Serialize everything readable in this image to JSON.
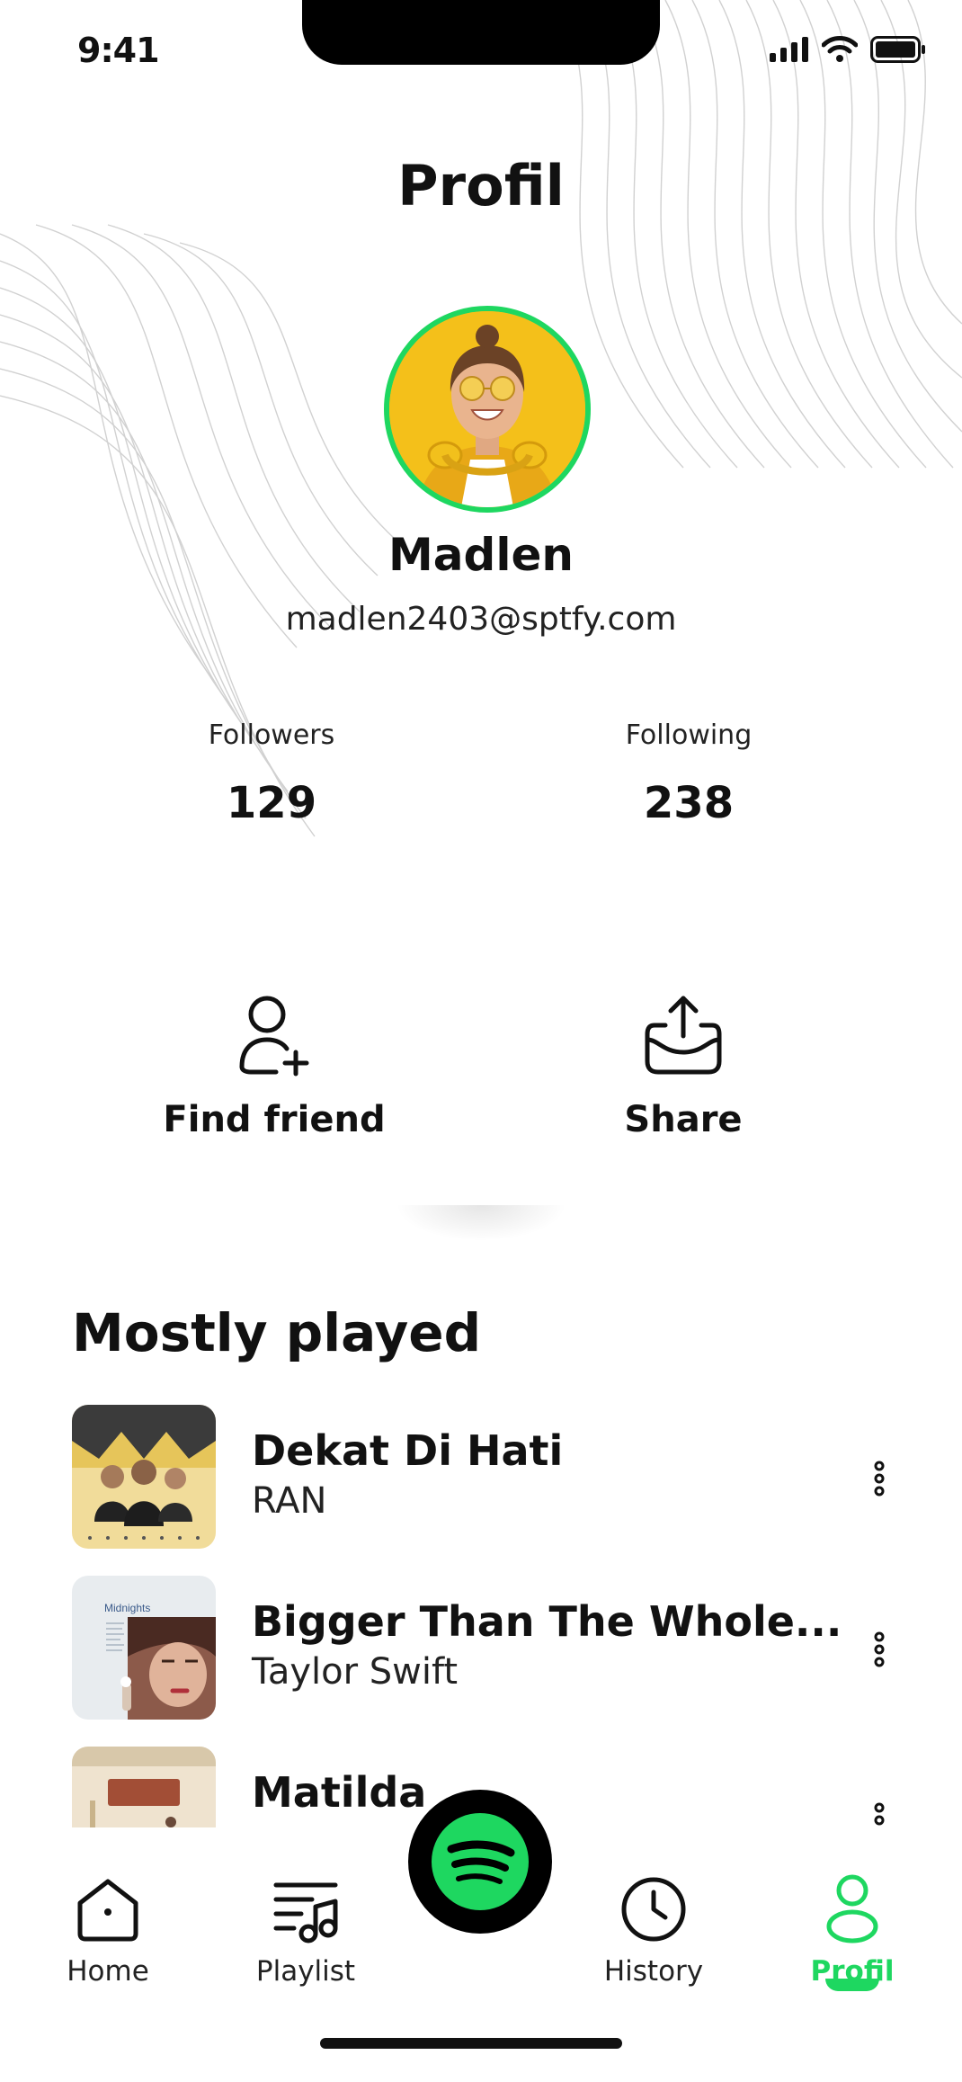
{
  "status_bar": {
    "time": "9:41"
  },
  "header": {
    "title": "Profil"
  },
  "profile": {
    "name": "Madlen",
    "email": "madlen2403@sptfy.com"
  },
  "stats": [
    {
      "label": "Followers",
      "value": "129"
    },
    {
      "label": "Following",
      "value": "238"
    }
  ],
  "actions": [
    {
      "label": "Find friend",
      "icon": "add-user-icon"
    },
    {
      "label": "Share",
      "icon": "share-icon"
    }
  ],
  "mostly_played": {
    "title": "Mostly played",
    "tracks": [
      {
        "title": "Dekat Di Hati",
        "artist": "RAN"
      },
      {
        "title": "Bigger Than The Whole...",
        "artist": "Taylor Swift",
        "art_text": "Midnights"
      },
      {
        "title": "Matilda",
        "artist": ""
      }
    ]
  },
  "nav": {
    "items": [
      {
        "label": "Home",
        "icon": "home-icon"
      },
      {
        "label": "Playlist",
        "icon": "playlist-icon"
      },
      {
        "label": "History",
        "icon": "clock-icon"
      },
      {
        "label": "Profil",
        "icon": "profile-icon"
      }
    ],
    "active": "Profil",
    "center_icon": "spotify-logo-icon"
  },
  "colors": {
    "accent": "#1ed760",
    "text": "#111111",
    "background": "#ffffff",
    "avatar_bg": "#f4c01a"
  }
}
